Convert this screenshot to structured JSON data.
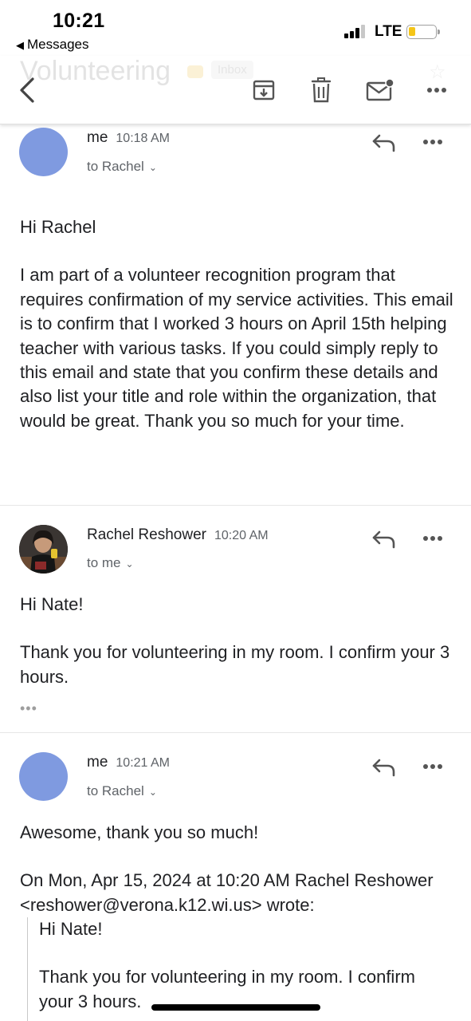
{
  "status_bar": {
    "time": "10:21",
    "back_app": "Messages",
    "network": "LTE",
    "battery_color": "#f5c518"
  },
  "toolbar": {
    "ghost_title": "Volunteering",
    "ghost_label": "Inbox",
    "icons": [
      "back-icon",
      "archive-icon",
      "delete-icon",
      "mark-unread-icon",
      "more-icon"
    ]
  },
  "messages": [
    {
      "sender": "me",
      "time": "10:18 AM",
      "recipient": "to Rachel",
      "avatar_color": "#7f9ae0",
      "body": [
        "Hi Rachel",
        "I am part of a volunteer recognition program that requires confirmation of my service activities. This email is to confirm that I worked 3 hours on April 15th helping teacher with various tasks. If you could simply reply to this email and state that you confirm these details and also list your title and role within the organization, that would be great. Thank you so much for your time."
      ]
    },
    {
      "sender": "Rachel Reshower",
      "time": "10:20 AM",
      "recipient": "to me",
      "body": [
        "Hi Nate!",
        "Thank you for volunteering in my room. I confirm your 3 hours."
      ],
      "quoted_toggle": "•••"
    },
    {
      "sender": "me",
      "time": "10:21 AM",
      "recipient": "to Rachel",
      "avatar_color": "#7f9ae0",
      "body": [
        "Awesome, thank you so much!",
        "On Mon, Apr 15, 2024 at 10:20 AM Rachel Reshower <reshower@verona.k12.wi.us> wrote:"
      ],
      "quoted": [
        "Hi Nate!",
        "Thank you for volunteering in my room. I confirm your 3 hours."
      ]
    }
  ]
}
